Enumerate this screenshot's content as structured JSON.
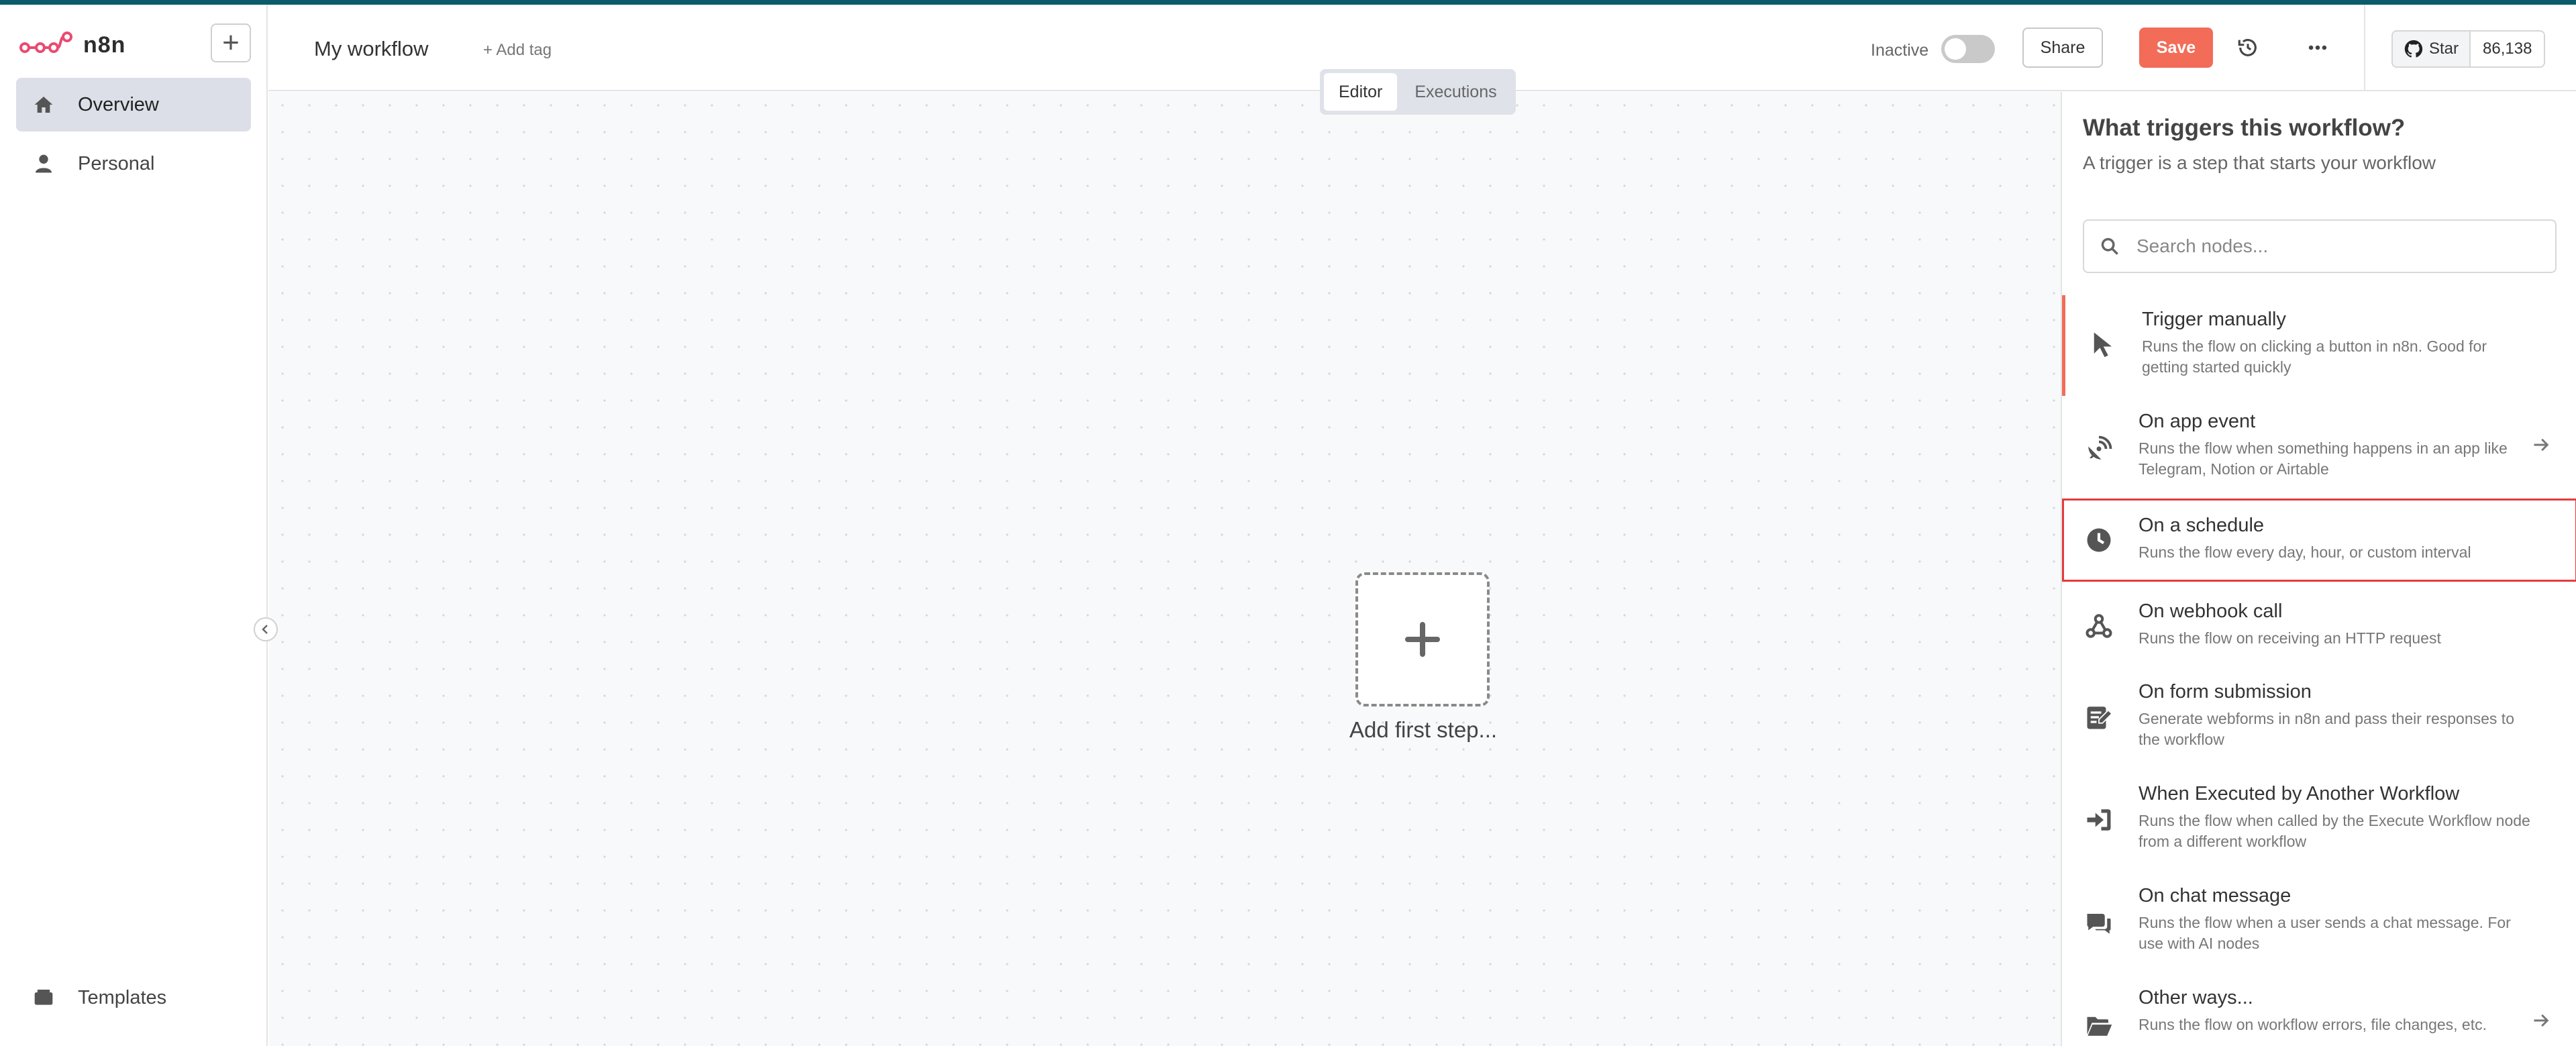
{
  "app": {
    "brand": "n8n"
  },
  "sidebar": {
    "new_button": "+",
    "items": [
      {
        "label": "Overview",
        "icon": "home-icon",
        "active": true
      },
      {
        "label": "Personal",
        "icon": "user-icon",
        "active": false
      }
    ],
    "footer_item": {
      "label": "Templates",
      "icon": "templates-icon"
    }
  },
  "header": {
    "workflow_name": "My workflow",
    "add_tag": "+ Add tag",
    "status_label": "Inactive",
    "share_label": "Share",
    "save_label": "Save",
    "github": {
      "label": "Star",
      "count": "86,138"
    }
  },
  "canvas": {
    "tabs": [
      {
        "label": "Editor",
        "active": true
      },
      {
        "label": "Executions",
        "active": false
      }
    ],
    "add_first_step": "Add first step..."
  },
  "panel": {
    "title": "What triggers this workflow?",
    "subtitle": "A trigger is a step that starts your workflow",
    "search_placeholder": "Search nodes...",
    "triggers": [
      {
        "title": "Trigger manually",
        "desc": "Runs the flow on clicking a button in n8n. Good for getting started quickly",
        "icon": "cursor-icon",
        "arrow": false
      },
      {
        "title": "On app event",
        "desc": "Runs the flow when something happens in an app like Telegram, Notion or Airtable",
        "icon": "satellite-icon",
        "arrow": true
      },
      {
        "title": "On a schedule",
        "desc": "Runs the flow every day, hour, or custom interval",
        "icon": "clock-icon",
        "arrow": false
      },
      {
        "title": "On webhook call",
        "desc": "Runs the flow on receiving an HTTP request",
        "icon": "webhook-icon",
        "arrow": false
      },
      {
        "title": "On form submission",
        "desc": "Generate webforms in n8n and pass their responses to the workflow",
        "icon": "form-icon",
        "arrow": false
      },
      {
        "title": "When Executed by Another Workflow",
        "desc": "Runs the flow when called by the Execute Workflow node from a different workflow",
        "icon": "sign-in-icon",
        "arrow": false
      },
      {
        "title": "On chat message",
        "desc": "Runs the flow when a user sends a chat message. For use with AI nodes",
        "icon": "chat-icon",
        "arrow": false
      },
      {
        "title": "Other ways...",
        "desc": "Runs the flow on workflow errors, file changes, etc.",
        "icon": "folder-icon",
        "arrow": true
      }
    ]
  },
  "colors": {
    "accent": "#f26c58",
    "top_bar": "#0b5b6b",
    "highlight_border": "#e23c3c"
  }
}
